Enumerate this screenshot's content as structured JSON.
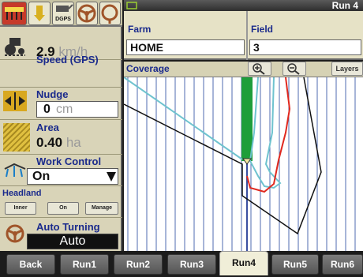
{
  "header": {
    "title": "Run 4"
  },
  "icons": {
    "gps_label": "DGPS"
  },
  "left": {
    "speed_label": "Speed (GPS)",
    "speed_value": "2.9",
    "speed_unit": "km/h",
    "nudge_label": "Nudge",
    "nudge_value": "0",
    "nudge_unit": "cm",
    "area_label": "Area",
    "area_value": "0.40",
    "area_unit": "ha",
    "work_label": "Work Control",
    "work_value": "On",
    "headland_label": "Headland",
    "headland_buttons": [
      "Inner",
      "On",
      "Manage"
    ],
    "auto_label": "Auto Turning",
    "auto_value": "Auto"
  },
  "field_header": {
    "farm_label": "Farm",
    "farm_value": "HOME",
    "field_label": "Field",
    "field_value": "3"
  },
  "coverage": {
    "label": "Coverage",
    "layers_label": "Layers"
  },
  "tabs": [
    "Back",
    "Run1",
    "Run2",
    "Run3",
    "Run4",
    "Run5",
    "Run6"
  ],
  "colors": {
    "accent": "#1a2a8c",
    "coverage": "#1e9e3a",
    "track_red": "#e0281e",
    "track_cyan": "#6fc3cf"
  }
}
